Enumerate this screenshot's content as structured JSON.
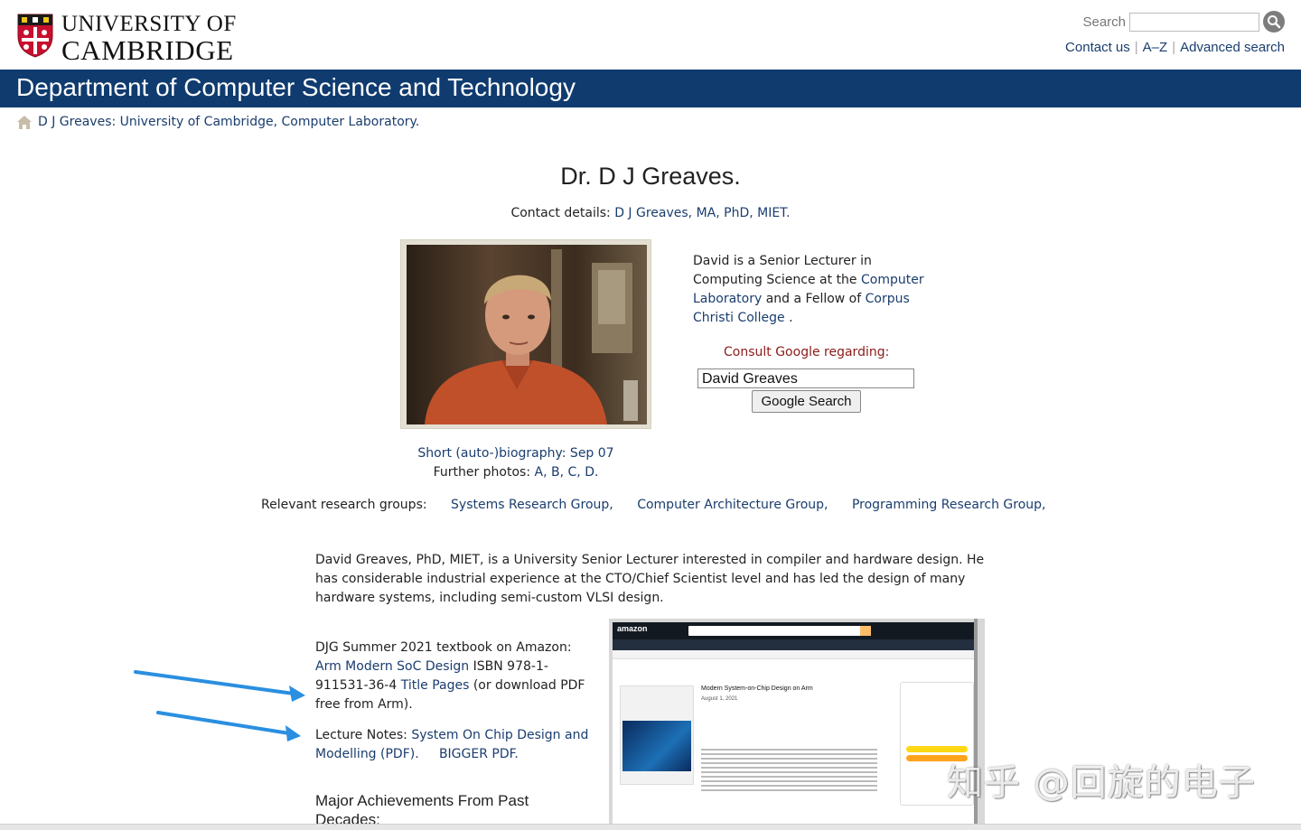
{
  "header": {
    "logo_line1": "UNIVERSITY OF",
    "logo_line2": "CAMBRIDGE",
    "search_label": "Search",
    "links": [
      "Contact us",
      "A–Z",
      "Advanced search"
    ],
    "department": "Department of Computer Science and Technology"
  },
  "breadcrumb": "D J Greaves: University of Cambridge, Computer Laboratory.",
  "page": {
    "title": "Dr. D J Greaves.",
    "contact_prefix": "Contact details:",
    "contact_link": "D J Greaves, MA, PhD, MIET."
  },
  "bio": {
    "t1": "David is a Senior Lecturer in Computing Science at the",
    "link_lab": "Computer Laboratory",
    "t2": "and a Fellow of",
    "link_college": "Corpus Christi College",
    "t3": "."
  },
  "google": {
    "consult": "Consult Google regarding:",
    "query": "David Greaves",
    "button": "Google Search"
  },
  "photo_links": {
    "short_bio": "Short (auto-)biography: Sep 07",
    "further": "Further photos:",
    "letters": [
      "A,",
      "B,",
      "C,",
      "D."
    ]
  },
  "groups": {
    "label": "Relevant research groups:",
    "items": [
      "Systems Research Group,",
      "Computer Architecture Group,",
      "Programming Research Group,"
    ]
  },
  "intro": "David Greaves, PhD, MIET, is a University Senior Lecturer interested in compiler and hardware design. He has considerable industrial experience at the CTO/Chief Scientist level and has led the design of many hardware systems, including semi-custom VLSI design.",
  "textbook": {
    "t1": "DJG Summer 2021 textbook on Amazon:",
    "link_book": "Arm Modern SoC Design",
    "t2": "ISBN 978-1-911531-36-4",
    "link_title": "Title Pages",
    "t3": "(or download PDF free from Arm)."
  },
  "lecture": {
    "prefix": "Lecture Notes:",
    "link_notes": "System On Chip Design and Modelling (PDF).",
    "link_bigger": "BIGGER PDF."
  },
  "achievements": "Major Achievements From Past Decades:",
  "amazon": {
    "logo": "amazon",
    "product_title": "Modern System-on-Chip Design on Arm",
    "product_date": "August 1, 2021"
  },
  "watermark": "知乎 @回旋的电子"
}
